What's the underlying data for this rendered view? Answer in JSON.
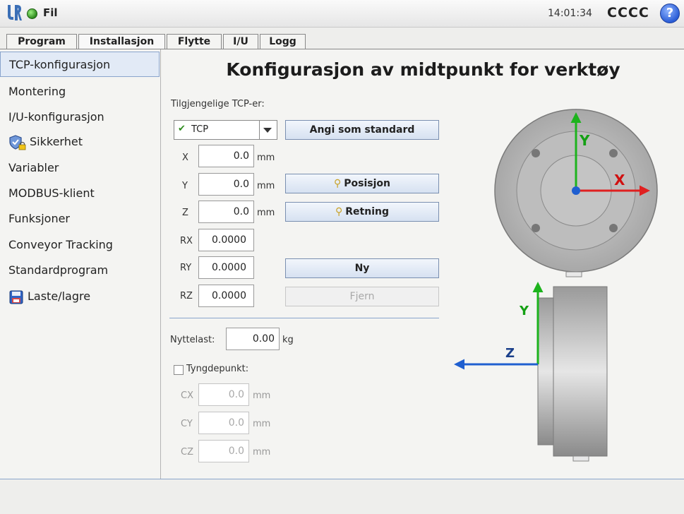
{
  "topbar": {
    "file_label": "Fil",
    "clock": "14:01:34",
    "robot_name": "CCCC",
    "help_label": "?"
  },
  "tabs": [
    {
      "label": "Program"
    },
    {
      "label": "Installasjon"
    },
    {
      "label": "Flytte"
    },
    {
      "label": "I/U"
    },
    {
      "label": "Logg"
    }
  ],
  "sidebar": {
    "items": [
      {
        "label": "TCP-konfigurasjon"
      },
      {
        "label": "Montering"
      },
      {
        "label": "I/U-konfigurasjon"
      },
      {
        "label": "Sikkerhet"
      },
      {
        "label": "Variabler"
      },
      {
        "label": "MODBUS-klient"
      },
      {
        "label": "Funksjoner"
      },
      {
        "label": "Conveyor Tracking"
      },
      {
        "label": "Standardprogram"
      },
      {
        "label": "Laste/lagre"
      }
    ]
  },
  "main": {
    "title": "Konfigurasjon av midtpunkt for verktøy",
    "available_tcps_label": "Tilgjengelige TCP-er:",
    "tcp_select_value": "TCP",
    "set_default_button": "Angi som standard",
    "fields": {
      "x": {
        "label": "X",
        "value": "0.0",
        "unit": "mm"
      },
      "y": {
        "label": "Y",
        "value": "0.0",
        "unit": "mm"
      },
      "z": {
        "label": "Z",
        "value": "0.0",
        "unit": "mm"
      },
      "rx": {
        "label": "RX",
        "value": "0.0000"
      },
      "ry": {
        "label": "RY",
        "value": "0.0000"
      },
      "rz": {
        "label": "RZ",
        "value": "0.0000"
      }
    },
    "position_button": "Posisjon",
    "orientation_button": "Retning",
    "new_button": "Ny",
    "remove_button": "Fjern",
    "payload": {
      "label": "Nyttelast:",
      "value": "0.00",
      "unit": "kg"
    },
    "cog": {
      "label": "Tyngdepunkt:",
      "cx": {
        "label": "CX",
        "value": "0.0",
        "unit": "mm"
      },
      "cy": {
        "label": "CY",
        "value": "0.0",
        "unit": "mm"
      },
      "cz": {
        "label": "CZ",
        "value": "0.0",
        "unit": "mm"
      }
    }
  },
  "diagram": {
    "front_x_label": "X",
    "front_y_label": "Y",
    "side_y_label": "Y",
    "side_z_label": "Z"
  },
  "colors": {
    "accent": "#8aa4cc",
    "axis_x": "#e02020",
    "axis_y": "#1db31d",
    "axis_z": "#1f5fd0"
  }
}
